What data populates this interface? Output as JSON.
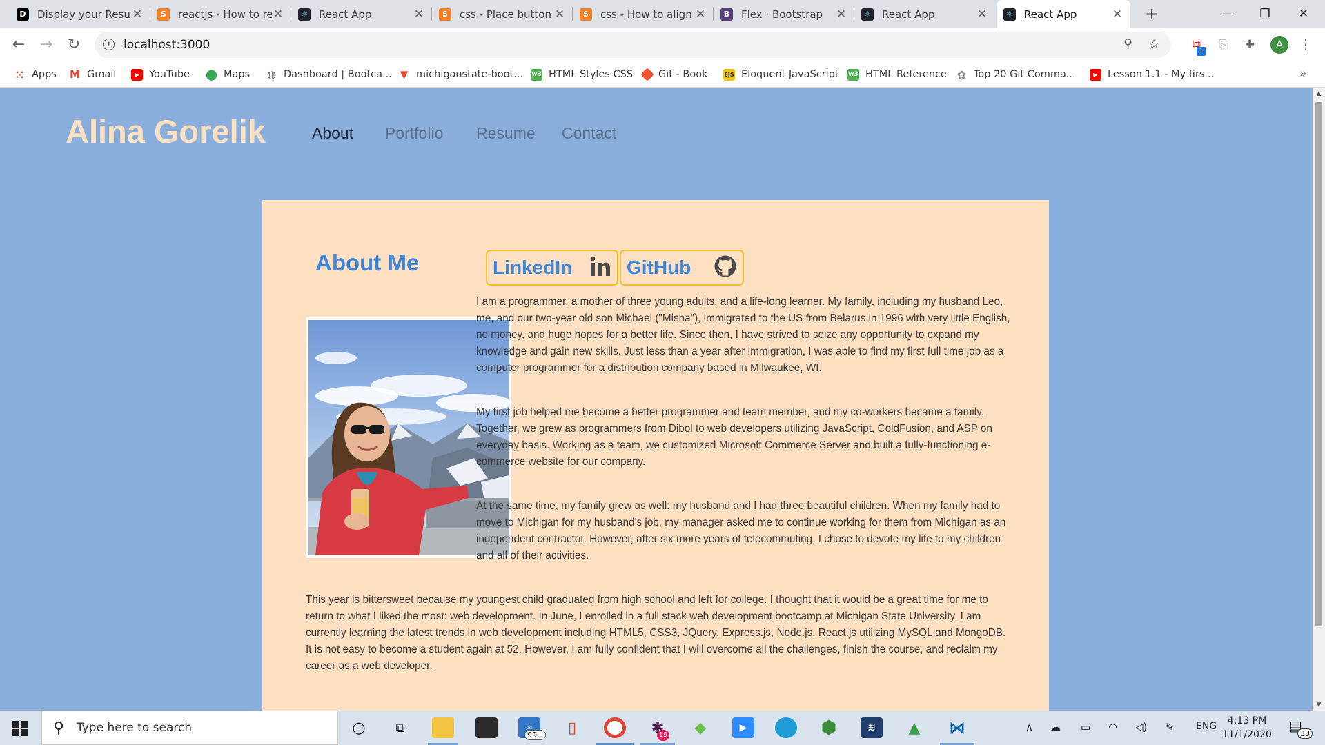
{
  "browser": {
    "tabs": [
      {
        "title": "Display your Resum",
        "favicon": "dev-icon",
        "color": "#000000",
        "active": false
      },
      {
        "title": "reactjs - How to re",
        "favicon": "stackoverflow-icon",
        "color": "#f48024",
        "active": false
      },
      {
        "title": "React App",
        "favicon": "react-icon",
        "color": "#20232a",
        "active": false
      },
      {
        "title": "css - Place button",
        "favicon": "stackoverflow-icon",
        "color": "#f48024",
        "active": false
      },
      {
        "title": "css - How to align",
        "favicon": "stackoverflow-icon",
        "color": "#f48024",
        "active": false
      },
      {
        "title": "Flex · Bootstrap",
        "favicon": "bootstrap-icon",
        "color": "#563d7c",
        "active": false
      },
      {
        "title": "React App",
        "favicon": "react-icon",
        "color": "#20232a",
        "active": false
      },
      {
        "title": "React App",
        "favicon": "react-icon",
        "color": "#20232a",
        "active": true
      }
    ],
    "url": "localhost:3000",
    "bookmarks": [
      {
        "label": "Apps",
        "icon": "apps-grid-icon",
        "color": "#e94235"
      },
      {
        "label": "Gmail",
        "icon": "gmail-icon",
        "color": "#ea4335"
      },
      {
        "label": "YouTube",
        "icon": "youtube-icon",
        "color": "#ff0000"
      },
      {
        "label": "Maps",
        "icon": "maps-icon",
        "color": "#34a853"
      },
      {
        "label": "Dashboard | Bootca...",
        "icon": "globe-icon",
        "color": "#5f6368"
      },
      {
        "label": "michiganstate-boot...",
        "icon": "gitlab-icon",
        "color": "#e24329"
      },
      {
        "label": "HTML Styles CSS",
        "icon": "w3schools-icon",
        "color": "#4caf50"
      },
      {
        "label": "Git - Book",
        "icon": "git-icon",
        "color": "#f05033"
      },
      {
        "label": "Eloquent JavaScript",
        "icon": "ejs-icon",
        "color": "#f0c419"
      },
      {
        "label": "HTML Reference",
        "icon": "w3schools-icon",
        "color": "#4caf50"
      },
      {
        "label": "Top 20 Git Comma...",
        "icon": "gear-site-icon",
        "color": "#8a8a8a"
      },
      {
        "label": "Lesson 1.1 - My firs...",
        "icon": "youtube-icon",
        "color": "#ff0000"
      }
    ],
    "profile_initial": "A",
    "extension_badge": "1"
  },
  "site": {
    "brand": "Alina Gorelik",
    "nav": [
      {
        "label": "About",
        "current": true
      },
      {
        "label": "Portfolio",
        "current": false
      },
      {
        "label": "Resume",
        "current": false
      },
      {
        "label": "Contact",
        "current": false
      }
    ],
    "about": {
      "title": "About Me",
      "linkedin_label": "LinkedIn",
      "github_label": "GitHub",
      "paragraphs": [
        "I am a programmer, a mother of three young adults, and a life-long learner. My family, including my husband Leo, me, and our two-year old son Michael (\"Misha\"), immigrated to the US from Belarus in 1996 with very little English, no money, and huge hopes for a better life. Since then, I have strived to seize any opportunity to expand my knowledge and gain new skills. Just less than a year after immigration, I was able to find my first full time job as a computer programmer for a distribution company based in Milwaukee, WI.",
        "My first job helped me become a better programmer and team member, and my co-workers became a family. Together, we grew as programmers from Dibol to web developers utilizing JavaScript, ColdFusion, and ASP on everyday basis. Working as a team, we customized Microsoft Commerce Server and built a fully-functioning e-commerce website for our company.",
        "At the same time, my family grew as well: my husband and I had three beautiful children. When my family had to move to Michigan for my husband's job, my manager asked me to continue working for them from Michigan as an independent contractor. However, after six more years of telecommuting, I chose to devote my life to my children and all of their activities.",
        "This year is bittersweet because my youngest child graduated from high school and left for college. I thought that it would be a great time for me to return to what I liked the most: web development. In June, I enrolled in a full stack web development bootcamp at Michigan State University. I am currently learning the latest trends in web development including HTML5, CSS3, JQuery, Express.js, Node.js, React.js utilizing MySQL and MongoDB. It is not easy to become a student again at 52. However, I am fully confident that I will overcome all the challenges, finish the course, and reclaim my career as a web developer."
      ]
    },
    "colors": {
      "page_bg": "#8aafdc",
      "card_bg": "#fde0c1",
      "brand": "#fbe1c2",
      "heading": "#3f86d9",
      "button_border": "#f2c026"
    }
  },
  "taskbar": {
    "search_placeholder": "Type here to search",
    "mail_badge": "99+",
    "slack_badge": "19",
    "language": "ENG",
    "time": "4:13 PM",
    "date": "11/1/2020",
    "notification_count": "38"
  }
}
